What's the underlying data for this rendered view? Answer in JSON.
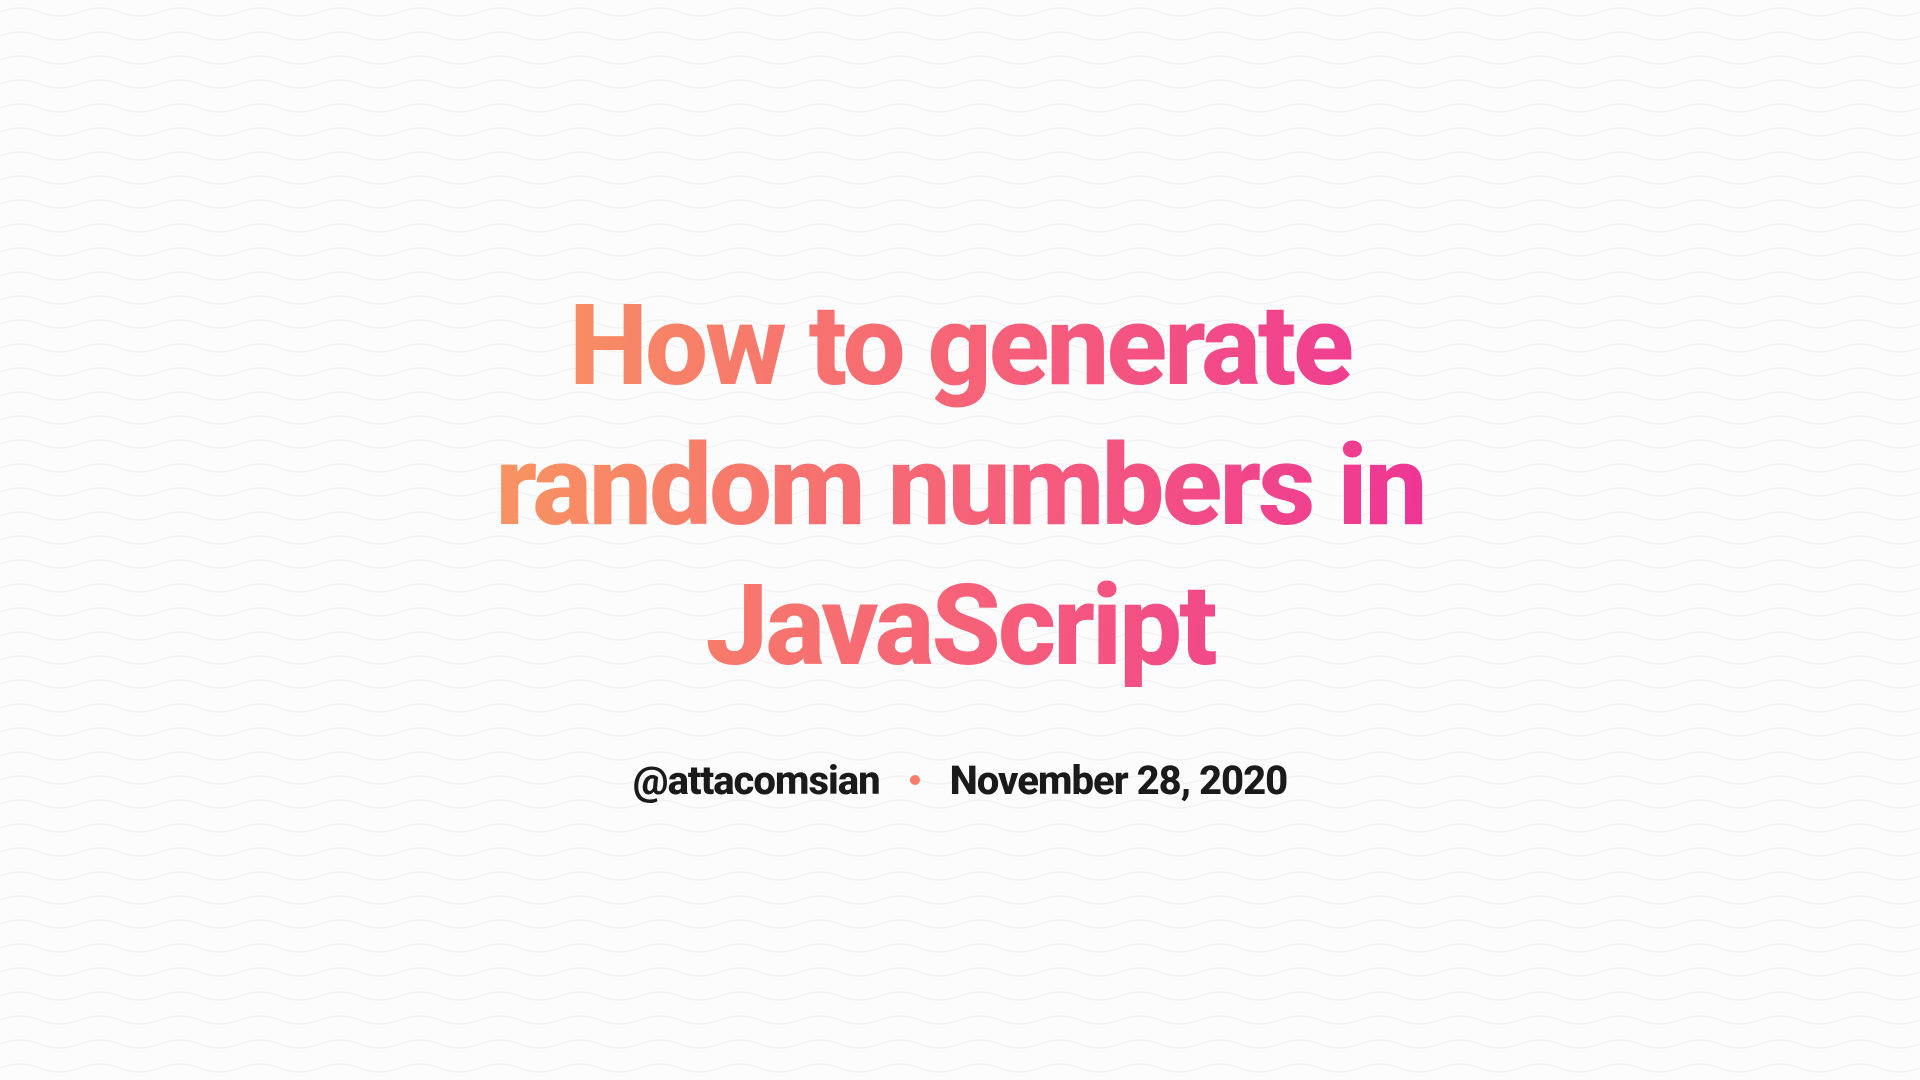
{
  "title": "How to generate random numbers in JavaScript",
  "author": "@attacomsian",
  "date": "November 28, 2020"
}
